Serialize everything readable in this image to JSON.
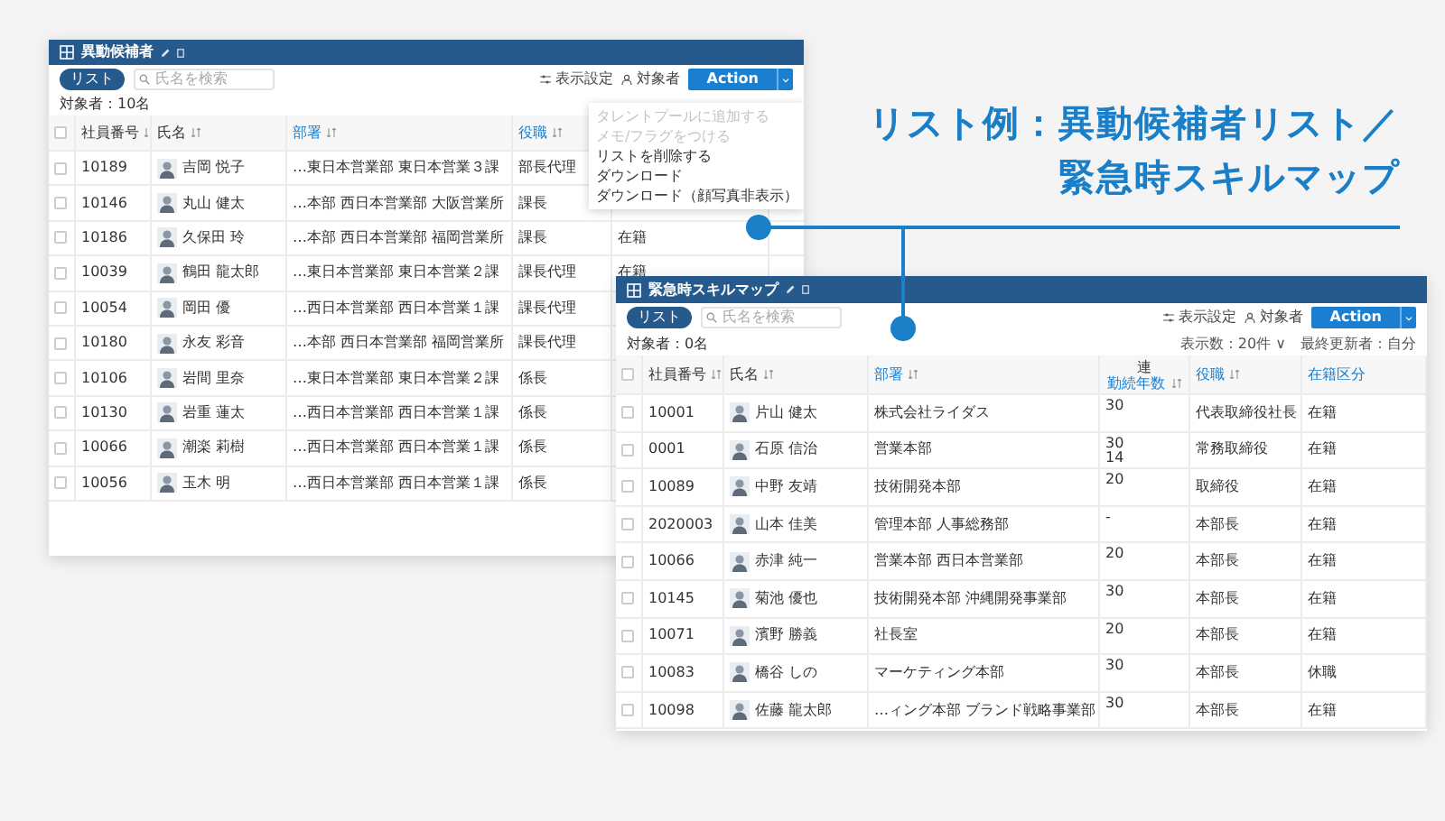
{
  "heading": [
    "リスト例：異動候補者リスト／",
    "緊急時スキルマップ"
  ],
  "windows": [
    {
      "title": "異動候補者",
      "all_checked": false,
      "list_button": "リスト",
      "search_placeholder": "氏名を検索",
      "tools": [
        "表示設定",
        "対象者"
      ],
      "action": "Action",
      "count": "対象者：10名",
      "columns": [
        {
          "kind": "id",
          "label": "社員番号",
          "highlighted": false
        },
        {
          "kind": "name",
          "label": "氏名",
          "highlighted": false
        },
        {
          "kind": "dept",
          "label": "部署",
          "highlighted": true
        },
        {
          "kind": "role",
          "label": "役職",
          "highlighted": true
        },
        {
          "kind": "status"
        }
      ],
      "rows": [
        {
          "checked": false,
          "id": "10189",
          "name": "吉岡 悦子",
          "dept": "…東日本営業部 東日本営業３課",
          "role": "部長代理"
        },
        {
          "checked": false,
          "id": "10146",
          "name": "丸山 健太",
          "dept": "…本部 西日本営業部 大阪営業所",
          "role": "課長"
        },
        {
          "checked": false,
          "id": "10186",
          "name": "久保田 玲",
          "dept": "…本部 西日本営業部 福岡営業所",
          "role": "課長",
          "status": "在籍"
        },
        {
          "checked": false,
          "id": "10039",
          "name": "鶴田 龍太郎",
          "dept": "…東日本営業部 東日本営業２課",
          "role": "課長代理",
          "status": "在籍"
        },
        {
          "checked": false,
          "id": "10054",
          "name": "岡田 優",
          "dept": "…西日本営業部 西日本営業１課",
          "role": "課長代理"
        },
        {
          "checked": false,
          "id": "10180",
          "name": "永友 彩音",
          "dept": "…本部 西日本営業部 福岡営業所",
          "role": "課長代理"
        },
        {
          "checked": false,
          "id": "10106",
          "name": "岩間 里奈",
          "dept": "…東日本営業部 東日本営業２課",
          "role": "係長"
        },
        {
          "checked": false,
          "id": "10130",
          "name": "岩重 蓮太",
          "dept": "…西日本営業部 西日本営業１課",
          "role": "係長"
        },
        {
          "checked": false,
          "id": "10066",
          "name": "潮楽 莉樹",
          "dept": "…西日本営業部 西日本営業１課",
          "role": "係長"
        },
        {
          "checked": false,
          "id": "10056",
          "name": "玉木 明",
          "dept": "…西日本営業部 西日本営業１課",
          "role": "係長"
        }
      ],
      "menu": [
        {
          "label": "タレントプールに追加する",
          "disabled": true
        },
        {
          "label": "メモ/フラグをつける",
          "disabled": true
        },
        {
          "label": "リストを削除する",
          "disabled": false
        },
        {
          "label": "ダウンロード",
          "disabled": false
        },
        {
          "label": "ダウンロード（顔写真非表示）",
          "disabled": false
        }
      ]
    },
    {
      "title": "緊急時スキルマップ",
      "all_checked": false,
      "list_button": "リスト",
      "search_placeholder": "氏名を検索",
      "tools": [
        "表示設定",
        "対象者"
      ],
      "action": "Action",
      "count": "対象者：0名",
      "display_count": "表示数：20件 ∨",
      "updated_by": "最終更新者：自分",
      "columns": [
        {
          "kind": "id",
          "label": "社員番号",
          "highlighted": false
        },
        {
          "kind": "name",
          "label": "氏名",
          "highlighted": false
        },
        {
          "kind": "dept",
          "label": "部署",
          "highlighted": true
        },
        {
          "kind": "num",
          "label": "連",
          "sublabel": "勤続年数",
          "highlighted": false
        },
        {
          "kind": "role",
          "label": "役職",
          "highlighted": true
        },
        {
          "kind": "status",
          "label": "在籍区分",
          "highlighted": true
        }
      ],
      "rows": [
        {
          "checked": false,
          "id": "10001",
          "name": "片山 健太",
          "dept": "株式会社ライダス",
          "num": "30",
          "role": "代表取締役社長",
          "status": "在籍"
        },
        {
          "checked": false,
          "id": "0001",
          "name": "石原 信治",
          "dept": "営業本部",
          "num": "30\n14",
          "role": "常務取締役",
          "status": "在籍"
        },
        {
          "checked": false,
          "id": "10089",
          "name": "中野 友靖",
          "dept": "技術開発本部",
          "num": "20",
          "role": "取締役",
          "status": "在籍"
        },
        {
          "checked": false,
          "id": "2020003",
          "name": "山本 佳美",
          "dept": "管理本部 人事総務部",
          "num": "-",
          "role": "本部長",
          "status": "在籍"
        },
        {
          "checked": false,
          "id": "10066",
          "name": "赤津 純一",
          "dept": "営業本部 西日本営業部",
          "num": "20",
          "role": "本部長",
          "status": "在籍"
        },
        {
          "checked": false,
          "id": "10145",
          "name": "菊池 優也",
          "dept": "技術開発本部 沖縄開発事業部",
          "num": "30",
          "role": "本部長",
          "status": "在籍"
        },
        {
          "checked": false,
          "id": "10071",
          "name": "濱野 勝義",
          "dept": "社長室",
          "num": "20",
          "role": "本部長",
          "status": "在籍"
        },
        {
          "checked": false,
          "id": "10083",
          "name": "橋谷 しの",
          "dept": "マーケティング本部",
          "num": "30",
          "role": "本部長",
          "status": "休職"
        },
        {
          "checked": false,
          "id": "10098",
          "name": "佐藤 龍太郎",
          "dept": "…ィング本部 ブランド戦略事業部",
          "num": "30",
          "role": "本部長",
          "status": "在籍"
        }
      ]
    }
  ]
}
